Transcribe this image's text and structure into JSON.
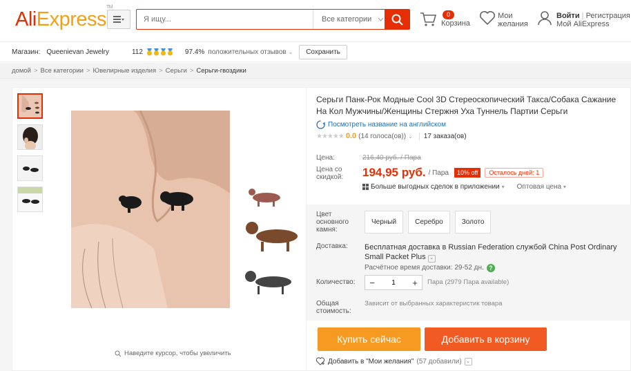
{
  "header": {
    "logo_ali": "Ali",
    "logo_express": "Express",
    "logo_tm": "TM",
    "search_placeholder": "Я ищу...",
    "search_category": "Все категории",
    "cart_count": "0",
    "cart_label": "Корзина",
    "wish_line1": "Мои",
    "wish_line2": "желания",
    "login": "Войти",
    "register": "Регистрация",
    "my_account": "Мой AliExpress"
  },
  "store": {
    "label": "Магазин:",
    "name": "Queenievan Jewelry",
    "score": "112",
    "positive_pct": "97.4%",
    "positive_label": "положительных отзывов",
    "save_label": "Сохранить"
  },
  "breadcrumb": [
    "домой",
    "Все категории",
    "Ювелирные изделия",
    "Серьги",
    "Серьги-гвоздики"
  ],
  "product": {
    "title": "Серьги Панк-Рок Модные Cool 3D Стереоскопический Такса/Собака Сажание На Кол Мужчины/Женщины Стержня Уха Туннель Партии Серьги",
    "translate_link": "Посмотреть название на английском",
    "rating": "0.0",
    "votes": "(14 голоса(ов))",
    "orders": "17 заказа(ов)",
    "price_label": "Цена:",
    "old_price": "216,40 руб. / Пара",
    "discount_price_label": "Цена со скидкой:",
    "new_price": "194,95 руб.",
    "unit": "/ Пара",
    "discount": "10% off",
    "days_left": "Осталось дней: 1",
    "app_deals": "Больше выгодных сделок в приложении",
    "wholesale": "Оптовая цена",
    "zoom_hint": "Наведите курсор, чтобы увеличить"
  },
  "options": {
    "color_label": "Цвет основного камня:",
    "colors": [
      "Черный",
      "Серебро",
      "Золото"
    ],
    "shipping_label": "Доставка:",
    "shipping_text": "Бесплатная доставка в Russian Federation службой China Post Ordinary Small Packet Plus",
    "delivery_time": "Расчётное время доставки: 29-52 дн.",
    "qty_label": "Количество:",
    "qty_value": "1",
    "qty_avail": "Пара (2979 Пара available)",
    "total_label": "Общая стоимость:",
    "total_note": "Зависит от выбранных характеристик товара"
  },
  "actions": {
    "buy_now": "Купить сейчас",
    "add_to_cart": "Добавить в корзину",
    "wishlist_add": "Добавить в \"Мои желания\"",
    "wishlist_count": "(57 добавили)"
  },
  "colors": {
    "brand_red": "#e62e04",
    "brand_orange": "#f0a015",
    "buy_btn": "#f79a22",
    "cart_btn": "#f15a22"
  }
}
